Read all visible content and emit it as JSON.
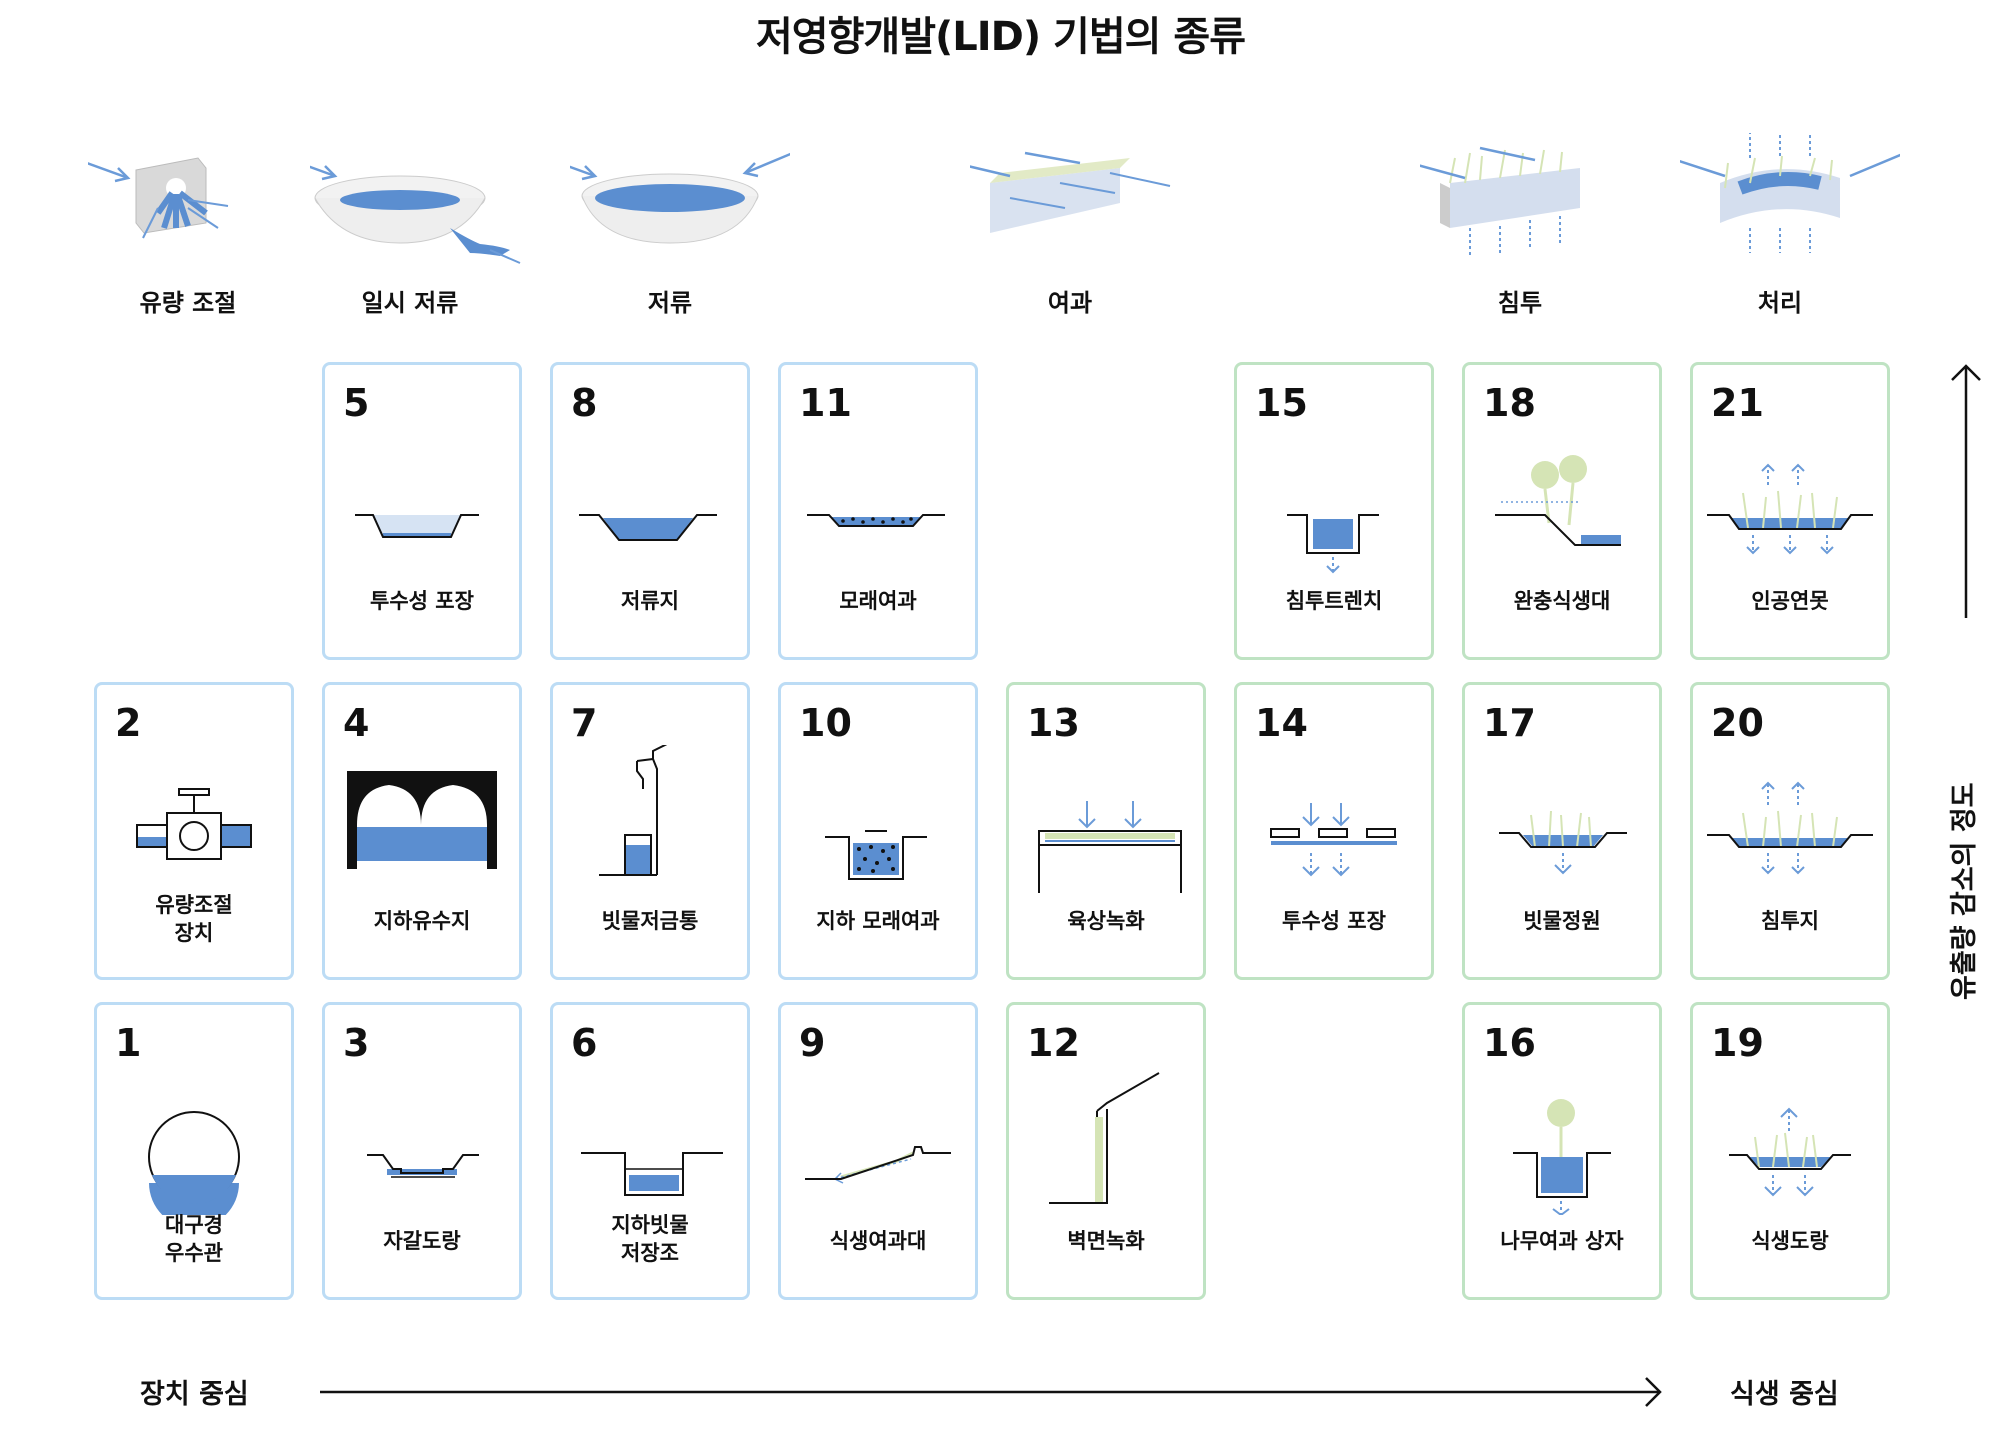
{
  "title": "저영향개발(LID) 기법의 종류",
  "functions": [
    "유량 조절",
    "일시 저류",
    "저류",
    "여과",
    "침투",
    "처리"
  ],
  "cards": [
    {
      "num": "1",
      "label": "대구경\n우수관"
    },
    {
      "num": "2",
      "label": "유량조절\n장치"
    },
    {
      "num": "3",
      "label": "자갈도랑"
    },
    {
      "num": "4",
      "label": "지하유수지"
    },
    {
      "num": "5",
      "label": "투수성 포장"
    },
    {
      "num": "6",
      "label": "지하빗물\n저장조"
    },
    {
      "num": "7",
      "label": "빗물저금통"
    },
    {
      "num": "8",
      "label": "저류지"
    },
    {
      "num": "9",
      "label": "식생여과대"
    },
    {
      "num": "10",
      "label": "지하 모래여과"
    },
    {
      "num": "11",
      "label": "모래여과"
    },
    {
      "num": "12",
      "label": "벽면녹화"
    },
    {
      "num": "13",
      "label": "육상녹화"
    },
    {
      "num": "14",
      "label": "투수성 포장"
    },
    {
      "num": "15",
      "label": "침투트렌치"
    },
    {
      "num": "16",
      "label": "나무여과 상자"
    },
    {
      "num": "17",
      "label": "빗물정원"
    },
    {
      "num": "18",
      "label": "완충식생대"
    },
    {
      "num": "19",
      "label": "식생도랑"
    },
    {
      "num": "20",
      "label": "침투지"
    },
    {
      "num": "21",
      "label": "인공연못"
    }
  ],
  "axis": {
    "x_start": "장치 중심",
    "x_end": "식생 중심",
    "y_label": "유출량 감소의 정도"
  },
  "colors": {
    "water": "#5b8ed0",
    "border_blue": "#bcdcf5",
    "border_green": "#bfe3c3",
    "plant": "#d5e4b5",
    "arrow": "#6b9bd8"
  }
}
